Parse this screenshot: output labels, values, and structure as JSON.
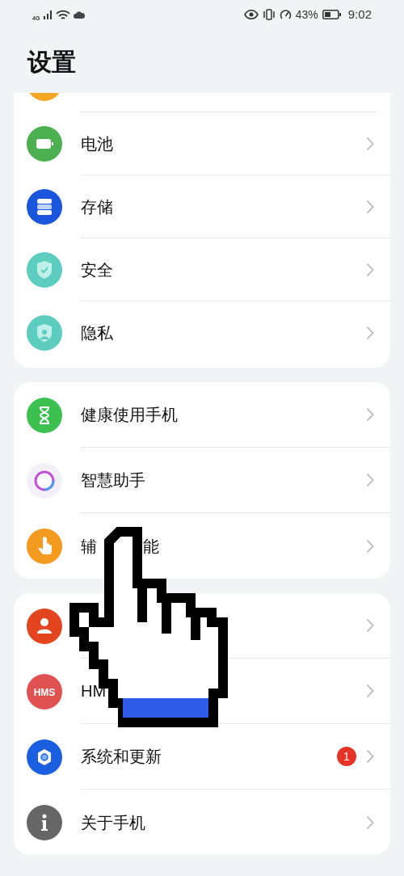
{
  "status_bar": {
    "network": "4G",
    "battery": "43%",
    "time": "9:02"
  },
  "title": "设置",
  "groups": [
    {
      "items": [
        {
          "label": "电池",
          "chevron": true
        },
        {
          "label": "存储",
          "chevron": true
        },
        {
          "label": "安全",
          "chevron": true
        },
        {
          "label": "隐私",
          "chevron": true
        }
      ]
    },
    {
      "items": [
        {
          "label": "健康使用手机",
          "chevron": true
        },
        {
          "label": "智慧助手",
          "chevron": true
        },
        {
          "label": "辅",
          "label_tail": "能",
          "chevron": true
        }
      ]
    },
    {
      "items": [
        {
          "chevron": true
        },
        {
          "label": "HM",
          "icon_text": "HMS",
          "chevron": true
        },
        {
          "label": "系统和更新",
          "badge": "1",
          "chevron": true
        },
        {
          "label": "关于手机",
          "chevron": true
        }
      ]
    }
  ]
}
